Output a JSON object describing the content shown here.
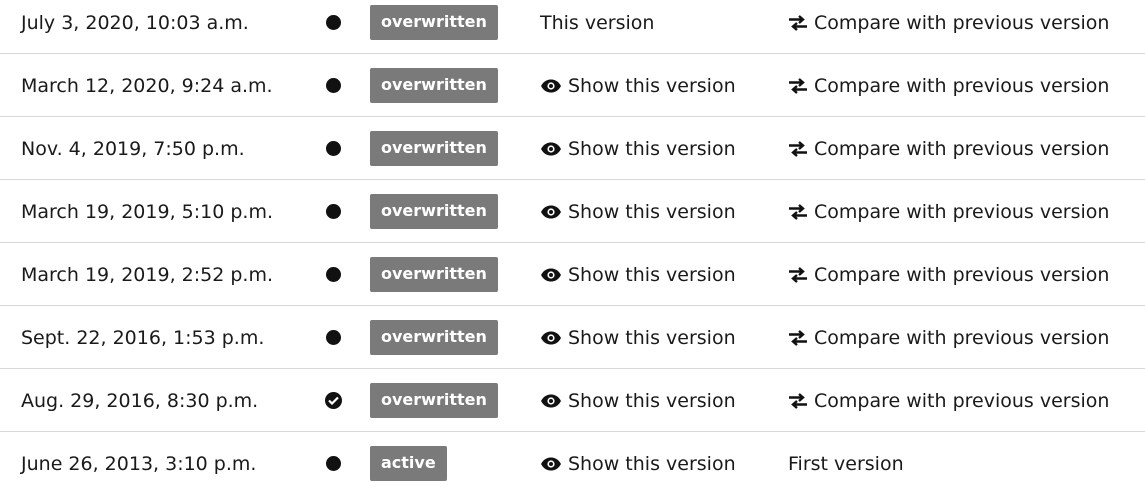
{
  "history": {
    "rows": [
      {
        "date": "July 3, 2020, 10:03 a.m.",
        "status_icon": "dot-icon",
        "badge": "overwritten",
        "show": "This version",
        "show_is_link": false,
        "compare": "Compare with previous version",
        "compare_is_link": true
      },
      {
        "date": "March 12, 2020, 9:24 a.m.",
        "status_icon": "dot-icon",
        "badge": "overwritten",
        "show": "Show this version",
        "show_is_link": true,
        "compare": "Compare with previous version",
        "compare_is_link": true
      },
      {
        "date": "Nov. 4, 2019, 7:50 p.m.",
        "status_icon": "dot-icon",
        "badge": "overwritten",
        "show": "Show this version",
        "show_is_link": true,
        "compare": "Compare with previous version",
        "compare_is_link": true
      },
      {
        "date": "March 19, 2019, 5:10 p.m.",
        "status_icon": "dot-icon",
        "badge": "overwritten",
        "show": "Show this version",
        "show_is_link": true,
        "compare": "Compare with previous version",
        "compare_is_link": true
      },
      {
        "date": "March 19, 2019, 2:52 p.m.",
        "status_icon": "dot-icon",
        "badge": "overwritten",
        "show": "Show this version",
        "show_is_link": true,
        "compare": "Compare with previous version",
        "compare_is_link": true
      },
      {
        "date": "Sept. 22, 2016, 1:53 p.m.",
        "status_icon": "dot-icon",
        "badge": "overwritten",
        "show": "Show this version",
        "show_is_link": true,
        "compare": "Compare with previous version",
        "compare_is_link": true
      },
      {
        "date": "Aug. 29, 2016, 8:30 p.m.",
        "status_icon": "check-circle-icon",
        "badge": "overwritten",
        "show": "Show this version",
        "show_is_link": true,
        "compare": "Compare with previous version",
        "compare_is_link": true
      },
      {
        "date": "June 26, 2013, 3:10 p.m.",
        "status_icon": "dot-icon",
        "badge": "active",
        "show": "Show this version",
        "show_is_link": true,
        "compare": "First version",
        "compare_is_link": false
      }
    ]
  },
  "colors": {
    "badge_bg": "#7a7a7a",
    "badge_text": "#ffffff",
    "text": "#1a1a1a",
    "divider": "#d9d9d9"
  }
}
